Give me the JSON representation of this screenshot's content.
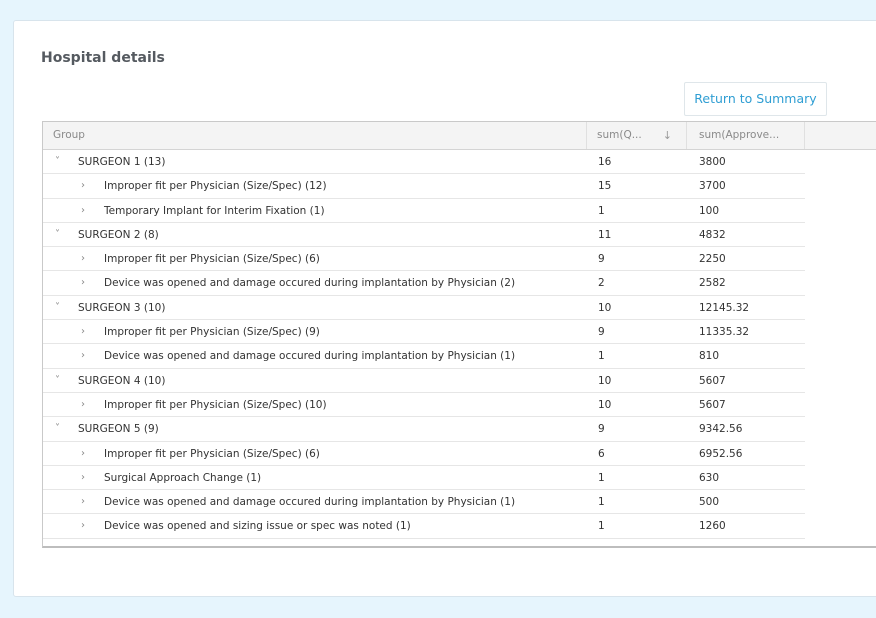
{
  "page": {
    "title": "Hospital details",
    "return_button": "Return to Summary"
  },
  "grid": {
    "headers": {
      "group": "Group",
      "qty": "sum(Q...",
      "approved": "sum(Approve..."
    },
    "icons": {
      "expanded": "chevron-down-icon",
      "collapsed": "chevron-right-icon",
      "sort": "sort-down-arrow-icon"
    },
    "rows": [
      {
        "level": "parent",
        "expand": "˅",
        "label": "SURGEON 1 (13)",
        "qty": "16",
        "approved": "3800"
      },
      {
        "level": "child",
        "expand": "›",
        "label": "Improper fit per Physician (Size/Spec) (12)",
        "qty": "15",
        "approved": "3700"
      },
      {
        "level": "child",
        "expand": "›",
        "label": "Temporary Implant for Interim Fixation (1)",
        "qty": "1",
        "approved": "100"
      },
      {
        "level": "parent",
        "expand": "˅",
        "label": "SURGEON 2 (8)",
        "qty": "11",
        "approved": "4832"
      },
      {
        "level": "child",
        "expand": "›",
        "label": "Improper fit per Physician (Size/Spec) (6)",
        "qty": "9",
        "approved": "2250"
      },
      {
        "level": "child",
        "expand": "›",
        "label": "Device was opened and damage occured during implantation by Physician (2)",
        "qty": "2",
        "approved": "2582"
      },
      {
        "level": "parent",
        "expand": "˅",
        "label": "SURGEON 3 (10)",
        "qty": "10",
        "approved": "12145.32"
      },
      {
        "level": "child",
        "expand": "›",
        "label": "Improper fit per Physician (Size/Spec) (9)",
        "qty": "9",
        "approved": "11335.32"
      },
      {
        "level": "child",
        "expand": "›",
        "label": "Device was opened and damage occured during implantation by Physician (1)",
        "qty": "1",
        "approved": "810"
      },
      {
        "level": "parent",
        "expand": "˅",
        "label": "SURGEON 4 (10)",
        "qty": "10",
        "approved": "5607"
      },
      {
        "level": "child",
        "expand": "›",
        "label": "Improper fit per Physician (Size/Spec) (10)",
        "qty": "10",
        "approved": "5607"
      },
      {
        "level": "parent",
        "expand": "˅",
        "label": "SURGEON 5 (9)",
        "qty": "9",
        "approved": "9342.56"
      },
      {
        "level": "child",
        "expand": "›",
        "label": "Improper fit per Physician (Size/Spec) (6)",
        "qty": "6",
        "approved": "6952.56"
      },
      {
        "level": "child",
        "expand": "›",
        "label": "Surgical Approach Change (1)",
        "qty": "1",
        "approved": "630"
      },
      {
        "level": "child",
        "expand": "›",
        "label": "Device was opened and damage occured during implantation by Physician (1)",
        "qty": "1",
        "approved": "500"
      },
      {
        "level": "child",
        "expand": "›",
        "label": "Device was opened and sizing issue or spec was noted (1)",
        "qty": "1",
        "approved": "1260"
      }
    ]
  }
}
